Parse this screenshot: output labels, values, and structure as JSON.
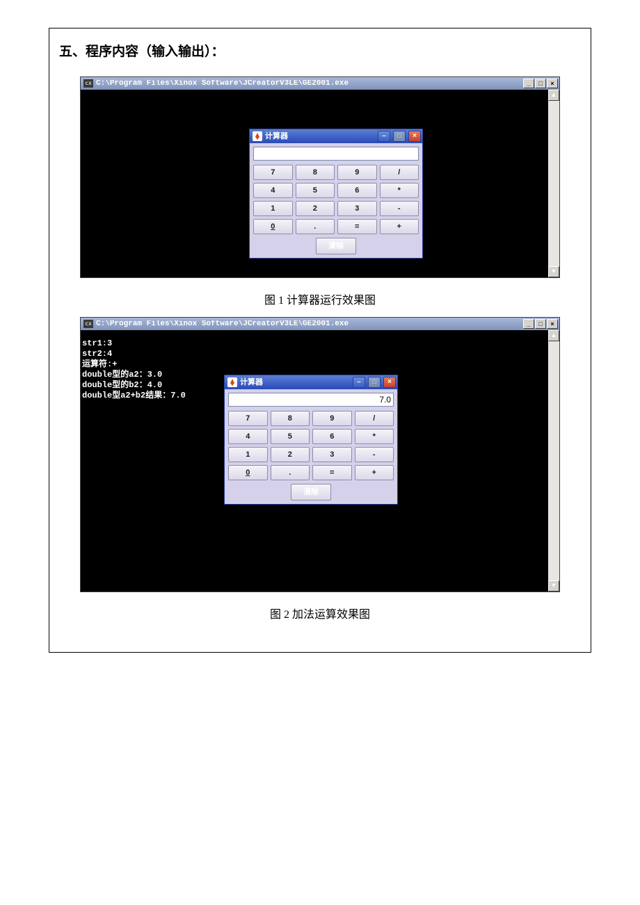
{
  "section_title": "五、程序内容（输入输出）：",
  "console_icon_text": "cx",
  "console_title": "C:\\Program Files\\Xinox Software\\JCreatorV3LE\\GE2001.exe",
  "calc": {
    "title": "计算器",
    "display1": "",
    "display2": "7.0",
    "keys": [
      "7",
      "8",
      "9",
      "/",
      "4",
      "5",
      "6",
      "*",
      "1",
      "2",
      "3",
      "-",
      "0",
      ".",
      "=",
      "+"
    ],
    "underline_index": 12,
    "clear_label": "清除"
  },
  "caption1": "图 1 计算器运行效果图",
  "console2_output": "str1:3\nstr2:4\n运算符:+\ndouble型的a2：3.0\ndouble型的b2：4.0\ndouble型a2+b2结果：7.0",
  "caption2": "图 2 加法运算效果图"
}
